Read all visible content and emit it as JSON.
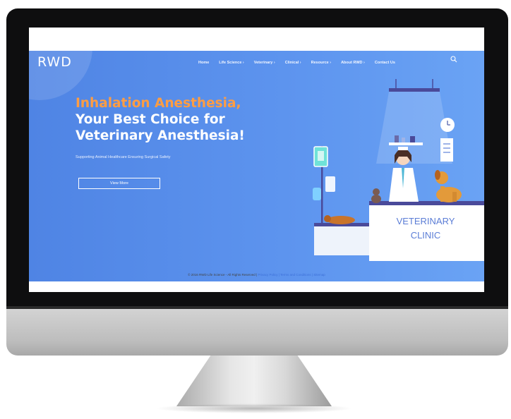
{
  "site": {
    "logo": "RWD"
  },
  "nav": {
    "items": [
      "Home",
      "Life Science ›",
      "Veterinary ›",
      "Clinical ›",
      "Resource ›",
      "About RWD ›",
      "Contact Us"
    ]
  },
  "hero": {
    "headline_1": "Inhalation Anesthesia,",
    "headline_2": "Your Best Choice for",
    "headline_3": "Veterinary Anesthesia!",
    "subtitle": "Supporting Animal Healthcare    Ensuring Surgical Safety",
    "button": "View More",
    "sign_line_1": "VETERINARY",
    "sign_line_2": "CLINIC"
  },
  "footer": {
    "copyright": "© 2016 RWD Life Science - All Rights Reserved  |",
    "links": "Privacy Policy | Terms and Conditions | Sitemap"
  },
  "colors": {
    "hero_bg": "#5b90ec",
    "accent": "#ff9d43"
  }
}
